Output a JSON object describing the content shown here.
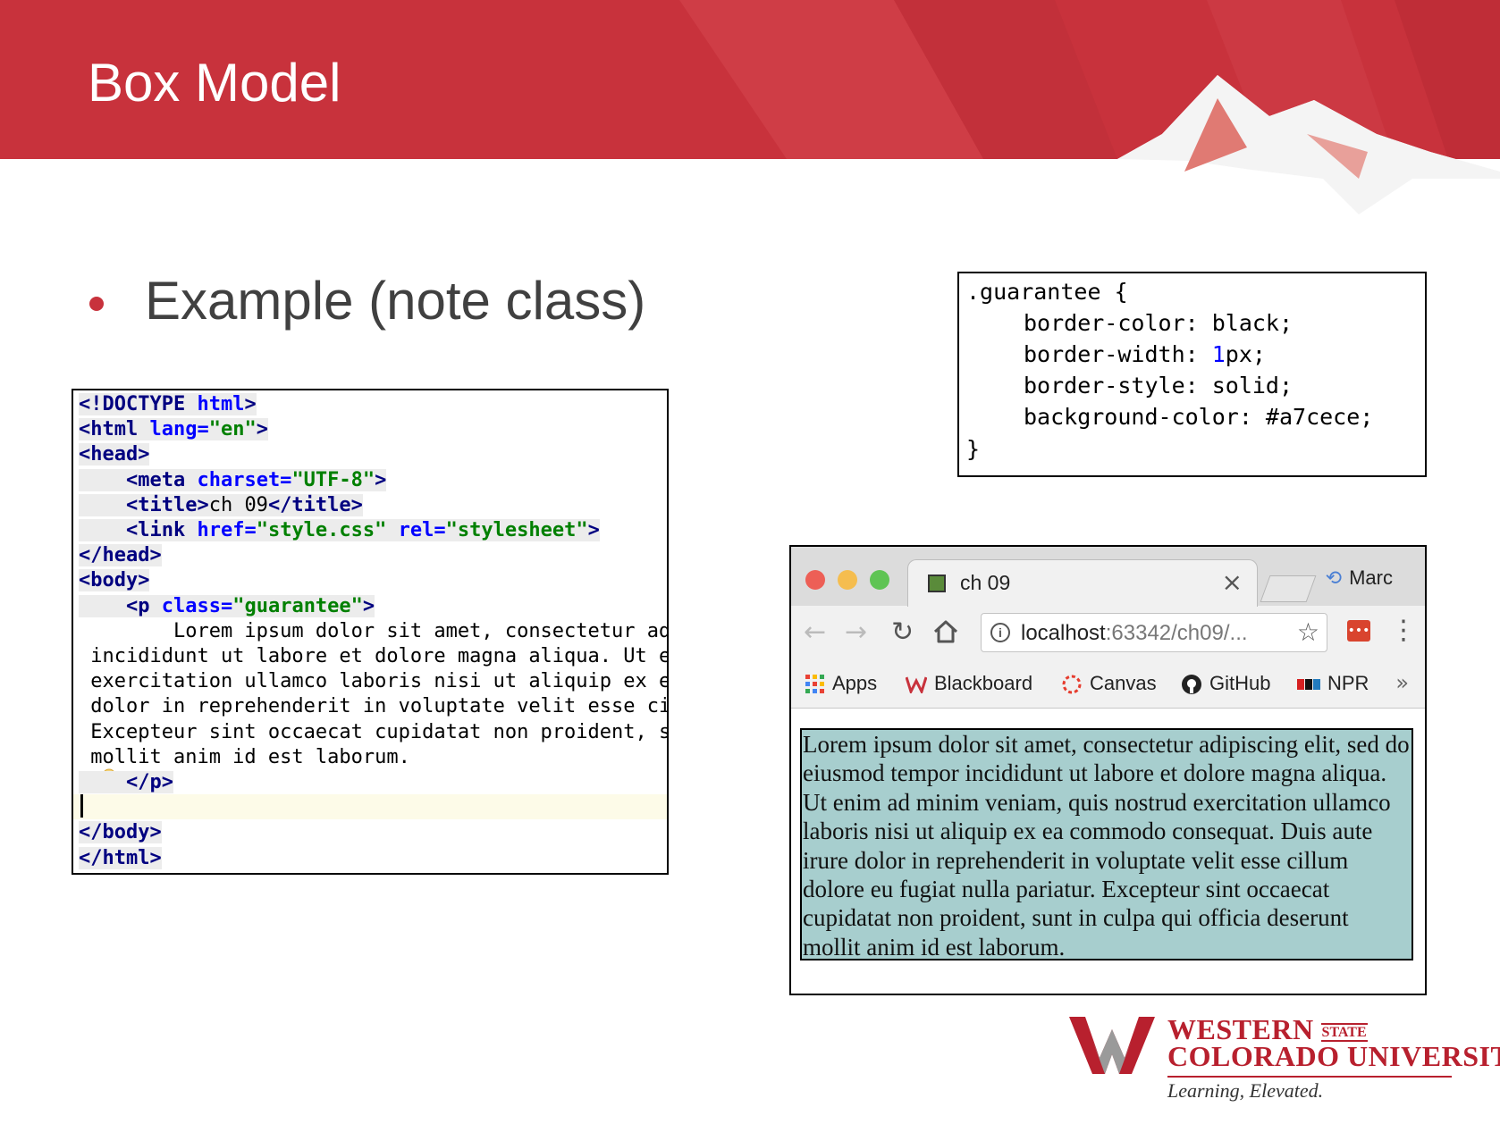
{
  "slide": {
    "title": "Box Model",
    "bullet": "Example (note class)",
    "colors": {
      "banner_red": "#c8323c",
      "accent": "#b8202e"
    }
  },
  "html_code": {
    "lines": [
      [
        [
          "tag",
          "<!DOCTYPE "
        ],
        [
          "attr",
          "html"
        ],
        [
          "tag",
          ">"
        ]
      ],
      [
        [
          "tag",
          "<html "
        ],
        [
          "attr",
          "lang="
        ],
        [
          "str",
          "\"en\""
        ],
        [
          "tag",
          ">"
        ]
      ],
      [
        [
          "tag",
          "<head>"
        ]
      ],
      [
        [
          "txt",
          "    "
        ],
        [
          "tag",
          "<meta "
        ],
        [
          "attr",
          "charset="
        ],
        [
          "str",
          "\"UTF-8\""
        ],
        [
          "tag",
          ">"
        ]
      ],
      [
        [
          "txt",
          "    "
        ],
        [
          "tag",
          "<title>"
        ],
        [
          "txt",
          "ch 09"
        ],
        [
          "tag",
          "</title>"
        ]
      ],
      [
        [
          "txt",
          "    "
        ],
        [
          "tag",
          "<link "
        ],
        [
          "attr",
          "href="
        ],
        [
          "str",
          "\"style.css\" "
        ],
        [
          "attr",
          "rel="
        ],
        [
          "str",
          "\"stylesheet\""
        ],
        [
          "tag",
          ">"
        ]
      ],
      [
        [
          "tag",
          "</head>"
        ]
      ],
      [
        [
          "tag",
          "<body>"
        ]
      ],
      [
        [
          "txt",
          "    "
        ],
        [
          "tag",
          "<p "
        ],
        [
          "attr",
          "class="
        ],
        [
          "str",
          "\"guarantee\""
        ],
        [
          "tag",
          ">"
        ]
      ],
      [
        [
          "txt",
          "        Lorem ipsum dolor sit amet, consectetur ad"
        ]
      ],
      [
        [
          "txt",
          " incididunt ut labore et dolore magna aliqua. Ut e"
        ]
      ],
      [
        [
          "txt",
          " exercitation ullamco laboris nisi ut aliquip ex e"
        ]
      ],
      [
        [
          "txt",
          " dolor in reprehenderit in voluptate velit esse ci"
        ]
      ],
      [
        [
          "txt",
          " Excepteur sint occaecat cupidatat non proident, s"
        ]
      ],
      [
        [
          "txt",
          " mollit anim id est laborum."
        ]
      ],
      [
        [
          "txt",
          "    "
        ],
        [
          "tag",
          "</p>"
        ]
      ],
      [
        [
          "txt",
          ""
        ]
      ],
      [
        [
          "tag",
          "</body>"
        ]
      ],
      [
        [
          "tag",
          "</html>"
        ]
      ]
    ]
  },
  "css_code": {
    "selector_line": ".guarantee {",
    "decl1": "border-color: black;",
    "decl2_prop": "border-width: ",
    "decl2_num": "1",
    "decl2_unit": "px;",
    "decl3": "border-style: solid;",
    "decl4": "background-color: #a7cece;",
    "close": "}"
  },
  "browser": {
    "tab_title": "ch 09",
    "tab_close": "×",
    "profile_name": "Marc",
    "url_host": "localhost",
    "url_rest": ":63342/ch09/...",
    "bookmarks": [
      "Apps",
      "Blackboard",
      "Canvas",
      "GitHub",
      "NPR"
    ],
    "bookmarks_more": "»",
    "paragraph": "Lorem ipsum dolor sit amet, consectetur adipiscing elit, sed do eiusmod tempor incididunt ut labore et dolore magna aliqua. Ut enim ad minim veniam, quis nostrud exercitation ullamco laboris nisi ut aliquip ex ea commodo consequat. Duis aute irure dolor in reprehenderit in voluptate velit esse cillum dolore eu fugiat nulla pariatur. Excepteur sint occaecat cupidatat non proident, sunt in culpa qui officia deserunt mollit anim id est laborum.",
    "paragraph_bg": "#a7cece",
    "icons": [
      "back-icon",
      "forward-icon",
      "reload-icon",
      "home-icon",
      "info-icon",
      "star-icon",
      "extension-icon",
      "menu-icon"
    ]
  },
  "logo": {
    "line1": "WESTERN",
    "state": "STATE",
    "line2": "COLORADO UNIVERSITY",
    "tagline": "Learning, Elevated."
  }
}
